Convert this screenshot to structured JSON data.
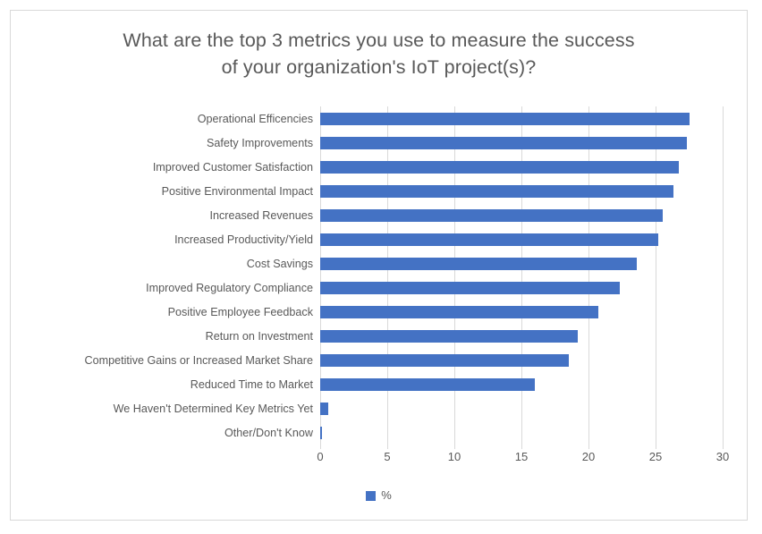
{
  "chart_data": {
    "type": "bar",
    "orientation": "horizontal",
    "title": "What are the top 3 metrics you use to measure the success of your organization's IoT project(s)?",
    "title_lines": [
      "What are the top 3 metrics you use to measure the success",
      "of your organization's IoT project(s)?"
    ],
    "categories": [
      "Operational Efficencies",
      "Safety Improvements",
      "Improved Customer Satisfaction",
      "Positive Environmental Impact",
      "Increased Revenues",
      "Increased Productivity/Yield",
      "Cost Savings",
      "Improved Regulatory Compliance",
      "Positive Employee Feedback",
      "Return on Investment",
      "Competitive Gains or Increased Market Share",
      "Reduced Time to Market",
      "We Haven't Determined Key Metrics Yet",
      "Other/Don't Know"
    ],
    "values": [
      27.5,
      27.3,
      26.7,
      26.3,
      25.5,
      25.2,
      23.6,
      22.3,
      20.7,
      19.2,
      18.5,
      16.0,
      0.6,
      0.1
    ],
    "series": [
      {
        "name": "%",
        "values": [
          27.5,
          27.3,
          26.7,
          26.3,
          25.5,
          25.2,
          23.6,
          22.3,
          20.7,
          19.2,
          18.5,
          16.0,
          0.6,
          0.1
        ],
        "color": "#4472C4"
      }
    ],
    "xlabel": "",
    "ylabel": "",
    "xlim": [
      0,
      30
    ],
    "xticks": [
      0,
      5,
      10,
      15,
      20,
      25,
      30
    ],
    "xtick_labels": [
      "0",
      "5",
      "10",
      "15",
      "20",
      "25",
      "30"
    ],
    "grid": true,
    "grid_axis": "x",
    "legend": {
      "position": "bottom",
      "entries": [
        {
          "label": "%",
          "color": "#4472C4"
        }
      ]
    },
    "colors": {
      "bar": "#4472C4",
      "grid": "#D9D9D9",
      "text": "#595959",
      "border": "#D9D9D9",
      "background": "#FFFFFF"
    }
  }
}
